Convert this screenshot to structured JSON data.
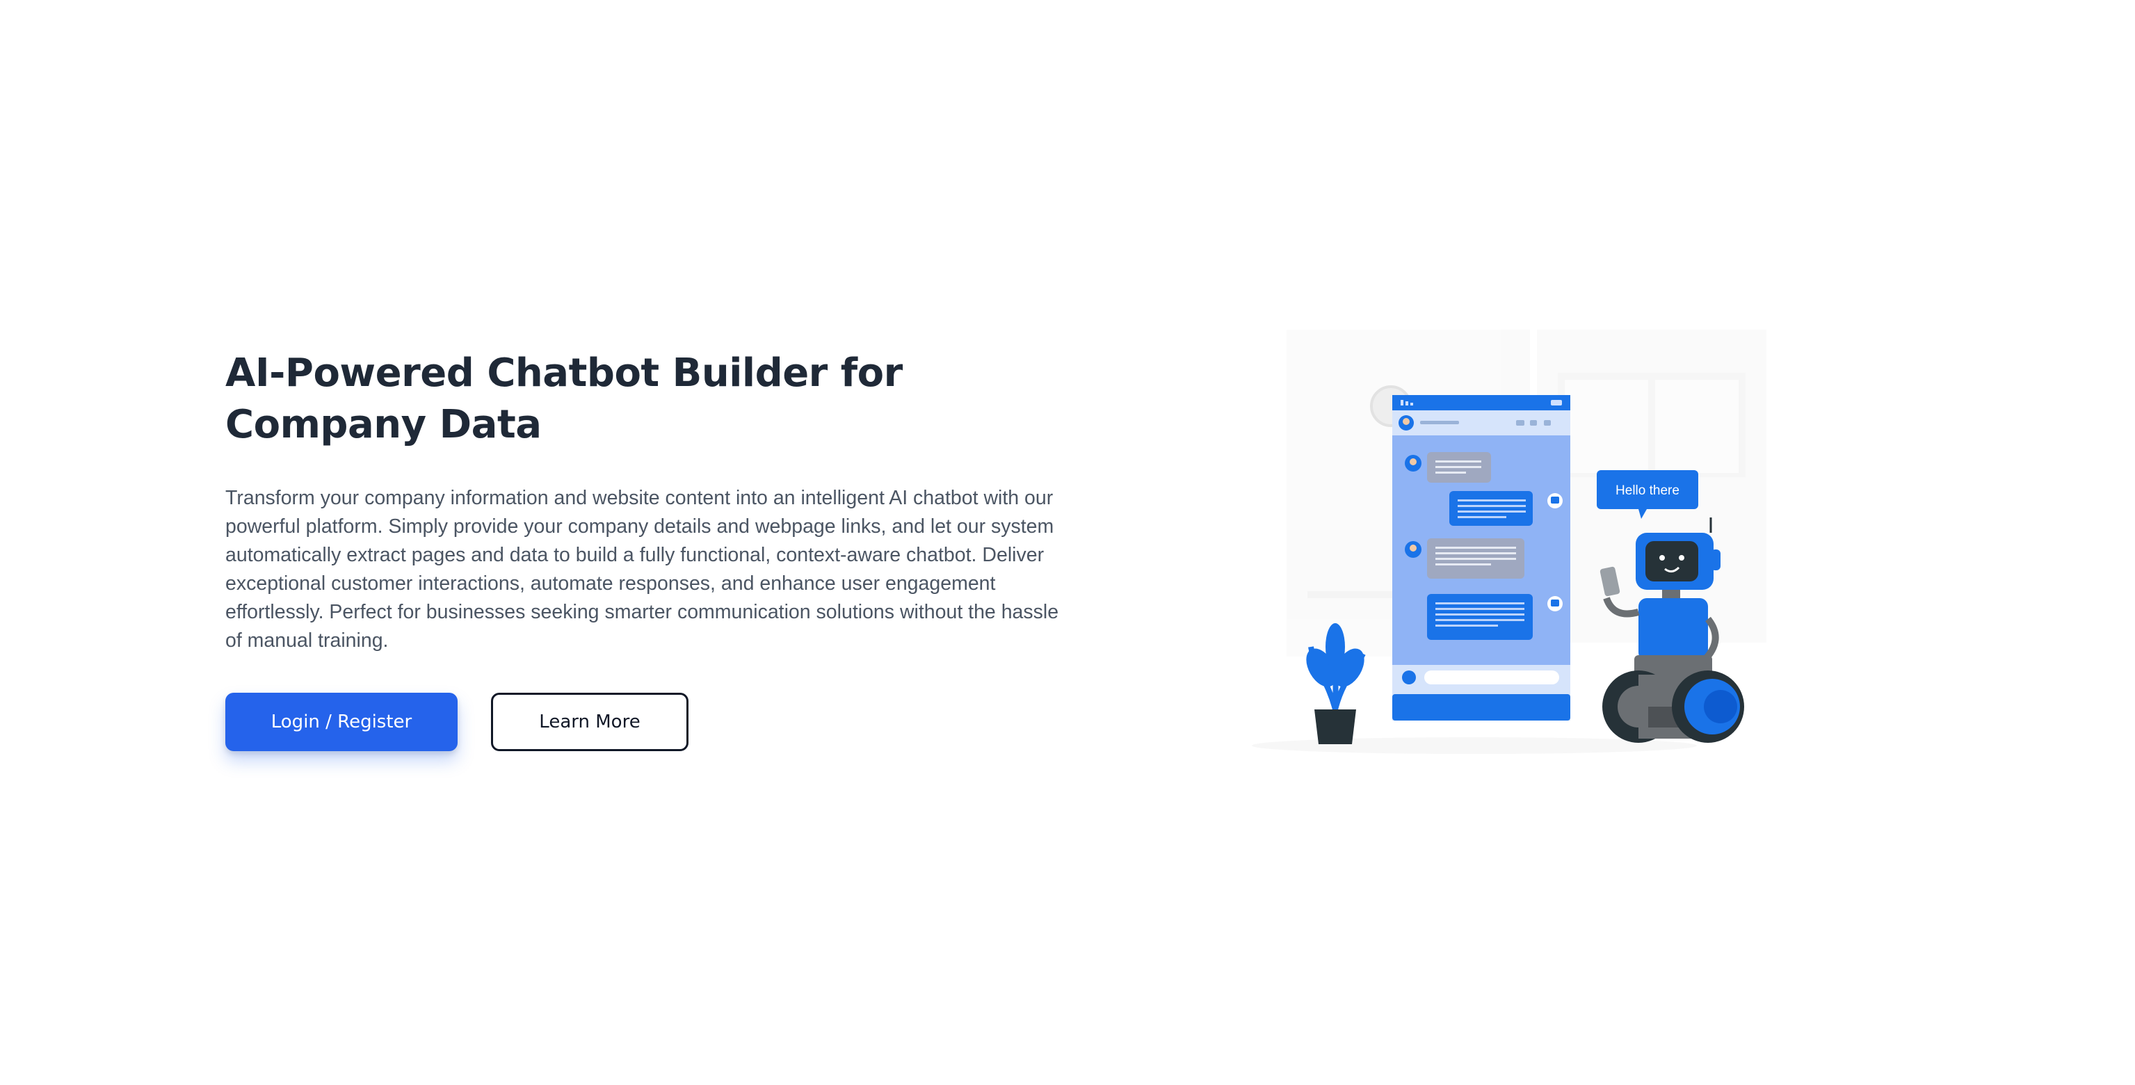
{
  "hero": {
    "title_line1": "AI-Powered Chatbot Builder for",
    "title_line2": "Company Data",
    "description": "Transform your company information and website content into an intelligent AI chatbot with our powerful platform. Simply provide your company details and webpage links, and let our system automatically extract pages and data to build a fully functional, context-aware chatbot. Deliver exceptional customer interactions, automate responses, and enhance user engagement effortlessly. Perfect for businesses seeking smarter communication solutions without the hassle of manual training."
  },
  "buttons": {
    "primary_label": "Login / Register",
    "secondary_label": "Learn More"
  },
  "illustration": {
    "speech_bubble": "Hello there",
    "colors": {
      "brand_blue": "#1a73e8",
      "light_blue": "#8fb3f5",
      "robot_gray": "#6b6f73",
      "pot_dark": "#263238"
    },
    "icons": [
      "chat-phone-illustration",
      "robot-illustration",
      "plant-illustration"
    ]
  },
  "colors": {
    "title": "#1f2937",
    "body_text": "#4b5563",
    "primary_button": "#2563eb"
  }
}
